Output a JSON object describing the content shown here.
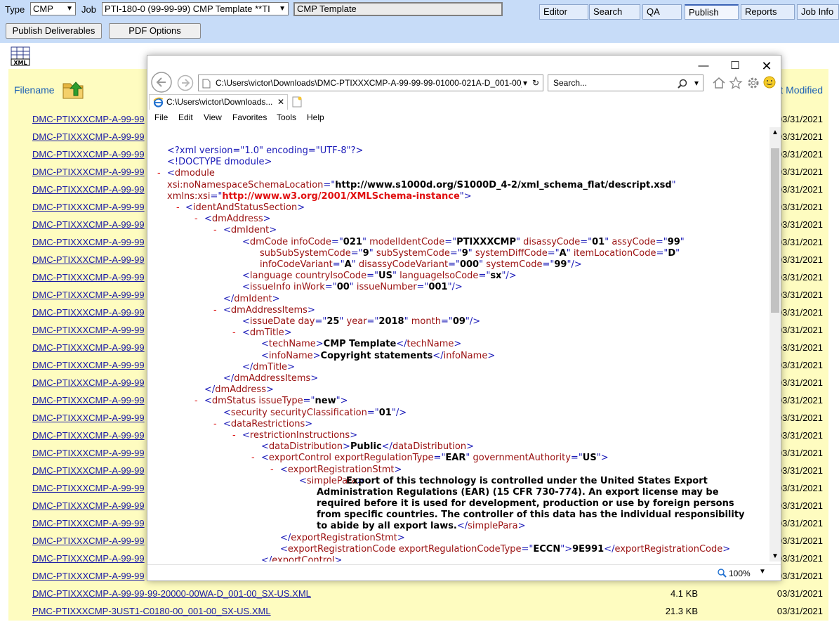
{
  "toolbar": {
    "type_label": "Type",
    "type_value": "CMP",
    "job_label": "Job",
    "job_value": "PTI-180-0 (99-99-99) CMP Template **TI",
    "template_box": "CMP Template",
    "tabs": [
      "Editor",
      "Search",
      "QA",
      "Publish",
      "Reports",
      "Job Info"
    ],
    "active_tab": "Publish"
  },
  "actions": {
    "publish_deliverables": "Publish Deliverables",
    "pdf_options": "PDF Options"
  },
  "list": {
    "xml_icon_text": "XML",
    "filename_header": "Filename",
    "modified_header_visible": "t Modified",
    "rows": [
      {
        "name": "DMC-PTIXXXCMP-A-99-99",
        "size": "",
        "date": "03/31/2021"
      },
      {
        "name": "DMC-PTIXXXCMP-A-99-99",
        "size": "",
        "date": "03/31/2021"
      },
      {
        "name": "DMC-PTIXXXCMP-A-99-99",
        "size": "",
        "date": "03/31/2021"
      },
      {
        "name": "DMC-PTIXXXCMP-A-99-99",
        "size": "",
        "date": "03/31/2021"
      },
      {
        "name": "DMC-PTIXXXCMP-A-99-99",
        "size": "",
        "date": "03/31/2021"
      },
      {
        "name": "DMC-PTIXXXCMP-A-99-99",
        "size": "",
        "date": "03/31/2021"
      },
      {
        "name": "DMC-PTIXXXCMP-A-99-99",
        "size": "",
        "date": "03/31/2021"
      },
      {
        "name": "DMC-PTIXXXCMP-A-99-99",
        "size": "",
        "date": "03/31/2021"
      },
      {
        "name": "DMC-PTIXXXCMP-A-99-99",
        "size": "",
        "date": "03/31/2021"
      },
      {
        "name": "DMC-PTIXXXCMP-A-99-99",
        "size": "",
        "date": "03/31/2021"
      },
      {
        "name": "DMC-PTIXXXCMP-A-99-99",
        "size": "",
        "date": "03/31/2021"
      },
      {
        "name": "DMC-PTIXXXCMP-A-99-99",
        "size": "",
        "date": "03/31/2021"
      },
      {
        "name": "DMC-PTIXXXCMP-A-99-99",
        "size": "",
        "date": "03/31/2021"
      },
      {
        "name": "DMC-PTIXXXCMP-A-99-99",
        "size": "",
        "date": "03/31/2021"
      },
      {
        "name": "DMC-PTIXXXCMP-A-99-99",
        "size": "",
        "date": "03/31/2021"
      },
      {
        "name": "DMC-PTIXXXCMP-A-99-99",
        "size": "",
        "date": "03/31/2021"
      },
      {
        "name": "DMC-PTIXXXCMP-A-99-99",
        "size": "",
        "date": "03/31/2021"
      },
      {
        "name": "DMC-PTIXXXCMP-A-99-99",
        "size": "",
        "date": "03/31/2021"
      },
      {
        "name": "DMC-PTIXXXCMP-A-99-99",
        "size": "",
        "date": "03/31/2021"
      },
      {
        "name": "DMC-PTIXXXCMP-A-99-99",
        "size": "",
        "date": "03/31/2021"
      },
      {
        "name": "DMC-PTIXXXCMP-A-99-99",
        "size": "",
        "date": "03/31/2021"
      },
      {
        "name": "DMC-PTIXXXCMP-A-99-99",
        "size": "",
        "date": "03/31/2021"
      },
      {
        "name": "DMC-PTIXXXCMP-A-99-99",
        "size": "",
        "date": "03/31/2021"
      },
      {
        "name": "DMC-PTIXXXCMP-A-99-99",
        "size": "",
        "date": "03/31/2021"
      },
      {
        "name": "DMC-PTIXXXCMP-A-99-99",
        "size": "",
        "date": "03/31/2021"
      },
      {
        "name": "DMC-PTIXXXCMP-A-99-99",
        "size": "",
        "date": "03/31/2021"
      },
      {
        "name": "DMC-PTIXXXCMP-A-99-99",
        "size": "",
        "date": "03/31/2021"
      },
      {
        "name": "DMC-PTIXXXCMP-A-99-99-99-20000-00WA-D_001-00_SX-US.XML",
        "size": "4.1 KB",
        "date": "03/31/2021"
      },
      {
        "name": "PMC-PTIXXXCMP-3UST1-C0180-00_001-00_SX-US.XML",
        "size": "21.3 KB",
        "date": "03/31/2021"
      }
    ]
  },
  "browser": {
    "address": "C:\\Users\\victor\\Downloads\\DMC-PTIXXXCMP-A-99-99-99-01000-021A-D_001-00_",
    "search_placeholder": "Search...",
    "tab_title": "C:\\Users\\victor\\Downloads...",
    "menu": [
      "File",
      "Edit",
      "View",
      "Favorites",
      "Tools",
      "Help"
    ],
    "zoom": "100%"
  },
  "xml": {
    "l1_decl": "<?xml version=\"1.0\" encoding=\"UTF-8\"?>",
    "l2_doctype": "<!DOCTYPE dmodule>",
    "dmodule": "dmodule",
    "nsloc_attr": "xsi:noNamespaceSchemaLocation",
    "nsloc_val": "http://www.s1000d.org/S1000D_4-2/xml_schema_flat/descript.xsd",
    "xmlns_attr": "xmlns:xsi",
    "xmlns_val": "http://www.w3.org/2001/XMLSchema-instance",
    "identAndStatusSection": "identAndStatusSection",
    "dmAddress": "dmAddress",
    "dmIdent": "dmIdent",
    "dmCode": "dmCode",
    "infoCode_a": "infoCode",
    "infoCode_v": "021",
    "modelIdentCode_a": "modelIdentCode",
    "modelIdentCode_v": "PTIXXXCMP",
    "disassyCode_a": "disassyCode",
    "disassyCode_v": "01",
    "assyCode_a": "assyCode",
    "assyCode_v": "99",
    "subSubSystemCode_a": "subSubSystemCode",
    "subSubSystemCode_v": "9",
    "subSystemCode_a": "subSystemCode",
    "subSystemCode_v": "9",
    "systemDiffCode_a": "systemDiffCode",
    "systemDiffCode_v": "A",
    "itemLocationCode_a": "itemLocationCode",
    "itemLocationCode_v": "D",
    "infoCodeVariant_a": "infoCodeVariant",
    "infoCodeVariant_v": "A",
    "disassyCodeVariant_a": "disassyCodeVariant",
    "disassyCodeVariant_v": "000",
    "systemCode_a": "systemCode",
    "systemCode_v": "99",
    "language": "language",
    "countryIsoCode_a": "countryIsoCode",
    "countryIsoCode_v": "US",
    "languageIsoCode_a": "languageIsoCode",
    "languageIsoCode_v": "sx",
    "issueInfo": "issueInfo",
    "inWork_a": "inWork",
    "inWork_v": "00",
    "issueNumber_a": "issueNumber",
    "issueNumber_v": "001",
    "dmAddressItems": "dmAddressItems",
    "issueDate": "issueDate",
    "day_a": "day",
    "day_v": "25",
    "year_a": "year",
    "year_v": "2018",
    "month_a": "month",
    "month_v": "09",
    "dmTitle": "dmTitle",
    "techName": "techName",
    "techName_text": "CMP Template",
    "infoName": "infoName",
    "infoName_text": "Copyright statements",
    "dmStatus": "dmStatus",
    "issueType_a": "issueType",
    "issueType_v": "new",
    "security": "security",
    "securityClassification_a": "securityClassification",
    "securityClassification_v": "01",
    "dataRestrictions": "dataRestrictions",
    "restrictionInstructions": "restrictionInstructions",
    "dataDistribution": "dataDistribution",
    "dataDistribution_text": "Public",
    "exportControl": "exportControl",
    "exportRegulationType_a": "exportRegulationType",
    "exportRegulationType_v": "EAR",
    "governmentAuthority_a": "governmentAuthority",
    "governmentAuthority_v": "US",
    "exportRegistrationStmt": "exportRegistrationStmt",
    "simplePara": "simplePara",
    "simplePara_text": "Export of this technology is controlled under the United States Export Administration Regulations (EAR) (15 CFR 730-774). An export license may be required before it is used for development, production or use by foreign persons from specific countries. The controller of this data has the individual responsibility to abide by all export laws.",
    "exportRegistrationCode": "exportRegistrationCode",
    "exportRegulationCodeType_a": "exportRegulationCodeType",
    "exportRegulationCodeType_v": "ECCN",
    "exportRegistrationCode_text": "9E991"
  },
  "colors": {
    "toolbar_bg": "#c7dcf8",
    "list_bg": "#fefcc0",
    "link": "#1a1aa6",
    "xml_tag": "#9a1010",
    "xml_markup": "#1a1ab8",
    "xml_collapse": "#d11"
  }
}
